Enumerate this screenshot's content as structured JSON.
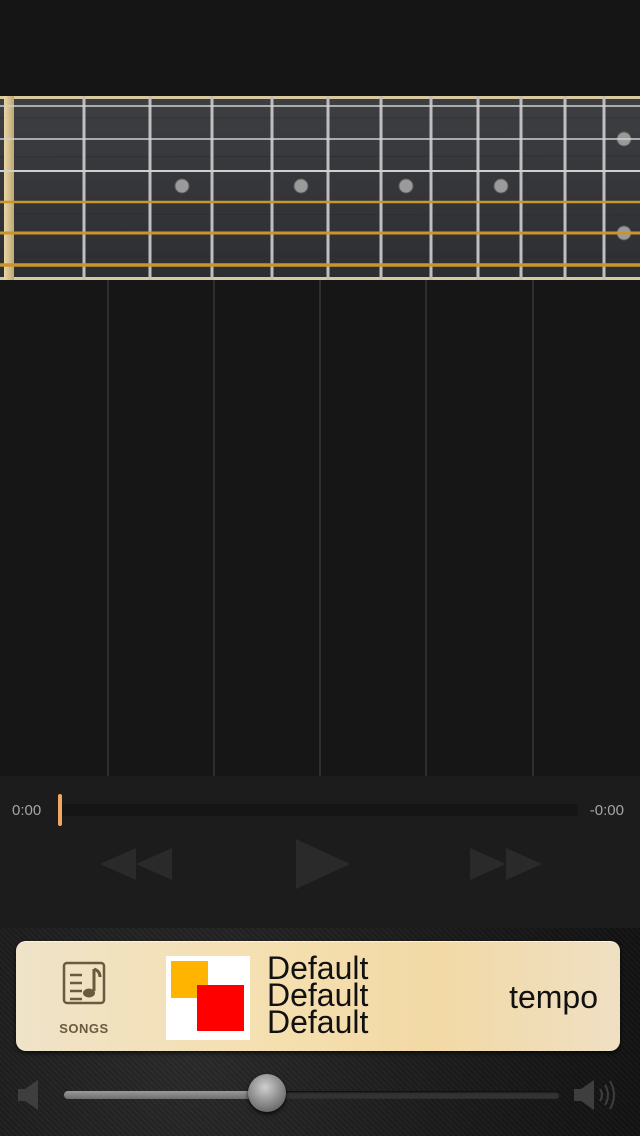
{
  "playback": {
    "elapsed": "0:00",
    "remaining": "-0:00",
    "progress_fraction": 0
  },
  "now_playing": {
    "songs_label": "SONGS",
    "track_lines": [
      "Default",
      "Default",
      "Default"
    ],
    "tempo_label": "tempo"
  },
  "volume": {
    "level_fraction": 0.41
  },
  "icons": {
    "songs": "music-note-sheet-icon",
    "rewind": "rewind-icon",
    "play": "play-icon",
    "forward": "fast-forward-icon",
    "volume_low": "speaker-low-icon",
    "volume_high": "speaker-high-icon"
  },
  "colors": {
    "accent_progress": "#f0a860",
    "panel": "#f5dfae",
    "album_yellow": "#ffb400",
    "album_red": "#ff0000"
  }
}
